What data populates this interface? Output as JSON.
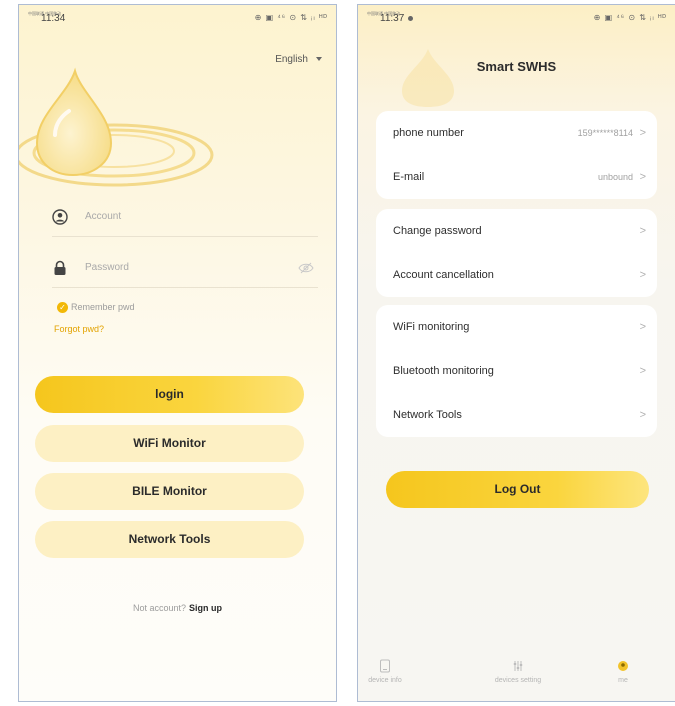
{
  "colors": {
    "accent": "#f5c61d",
    "accent_soft": "#fdf0c4",
    "link": "#e3a300"
  },
  "left": {
    "status": {
      "carrier": "中国联通 中国移动",
      "time": "11:34",
      "icons": "⊕ ▣ ⁴⁶ ⊙ ⇅ ᵢₗ ᴴᴰ"
    },
    "language": "English",
    "account_placeholder": "Account",
    "password_placeholder": "Password",
    "remember": "Remember pwd",
    "forgot": "Forgot pwd?",
    "buttons": {
      "login": "login",
      "wifi": "WiFi Monitor",
      "ble": "BILE Monitor",
      "network": "Network Tools"
    },
    "signup_prompt": "Not account?",
    "signup_link": "Sign up"
  },
  "right": {
    "status": {
      "carrier": "中国联通 中国移动",
      "time": "11:37",
      "icons": "⊕ ▣ ⁴⁶ ⊙ ⇅ ᵢₗ ᴴᴰ"
    },
    "title": "Smart SWHS",
    "groups": [
      [
        {
          "label": "phone number",
          "value": "159******8114"
        },
        {
          "label": "E-mail",
          "value": "unbound"
        }
      ],
      [
        {
          "label": "Change password"
        },
        {
          "label": "Account cancellation"
        }
      ],
      [
        {
          "label": "WiFi monitoring"
        },
        {
          "label": "Bluetooth monitoring"
        },
        {
          "label": "Network Tools"
        }
      ]
    ],
    "logout": "Log Out",
    "tabs": [
      {
        "label": "device info",
        "icon": "device-icon"
      },
      {
        "label": "devices setting",
        "icon": "settings-icon"
      },
      {
        "label": "me",
        "icon": "me-icon"
      }
    ]
  }
}
